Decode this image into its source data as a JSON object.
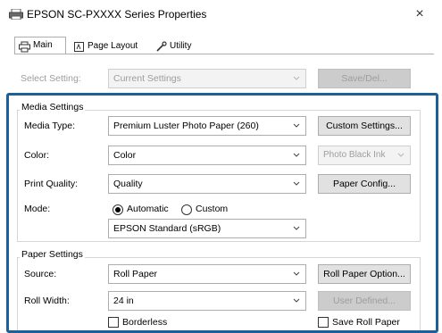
{
  "window": {
    "title": "EPSON SC-PXXXX Series Properties",
    "close_glyph": "×",
    "title_icon": "printer-icon"
  },
  "tabs": [
    {
      "label": "Main",
      "icon": "printer-icon",
      "selected": true
    },
    {
      "label": "Page Layout",
      "icon": "page-icon",
      "selected": false
    },
    {
      "label": "Utility",
      "icon": "wrench-icon",
      "selected": false
    }
  ],
  "select_setting": {
    "label": "Select Setting:",
    "value": "Current Settings",
    "button": "Save/Del..."
  },
  "media_settings": {
    "legend": "Media Settings",
    "media_type_label": "Media Type:",
    "media_type_value": "Premium Luster Photo Paper (260)",
    "custom_settings_button": "Custom Settings...",
    "color_label": "Color:",
    "color_value": "Color",
    "ink_value": "Photo Black Ink",
    "print_quality_label": "Print Quality:",
    "print_quality_value": "Quality",
    "paper_config_button": "Paper Config...",
    "mode_label": "Mode:",
    "mode_automatic": "Automatic",
    "mode_custom": "Custom",
    "mode_selected": "Automatic",
    "color_mode_value": "EPSON Standard (sRGB)"
  },
  "paper_settings": {
    "legend": "Paper Settings",
    "source_label": "Source:",
    "source_value": "Roll Paper",
    "roll_paper_option_button": "Roll Paper Option...",
    "roll_width_label": "Roll Width:",
    "roll_width_value": "24 in",
    "user_defined_button": "User Defined...",
    "borderless_label": "Borderless",
    "borderless_checked": false,
    "save_roll_paper_label": "Save Roll Paper",
    "save_roll_paper_checked": false
  },
  "colors": {
    "highlight_frame": "#1d5f97",
    "disabled_text": "#9d9d9d"
  }
}
